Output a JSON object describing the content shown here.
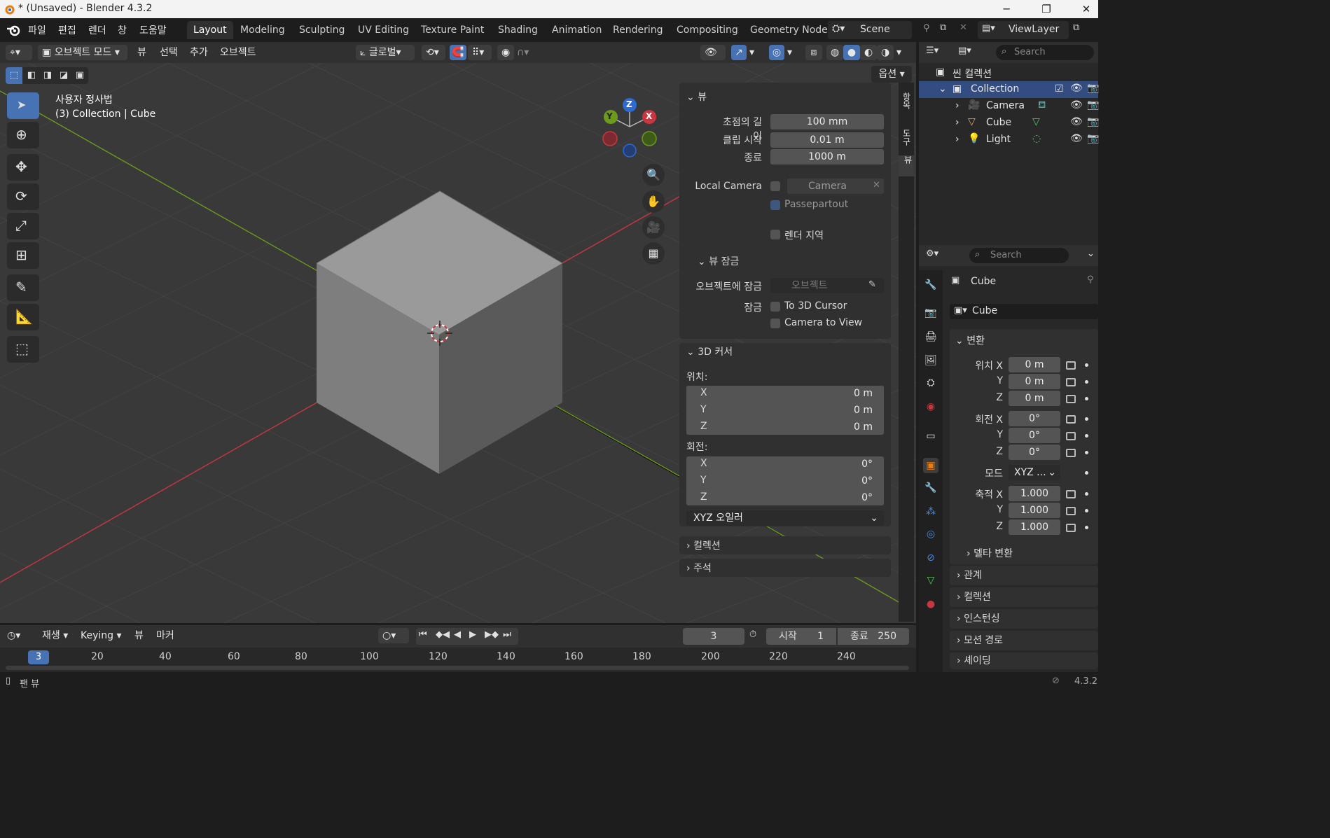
{
  "app": {
    "title": "* (Unsaved) - Blender 4.3.2"
  },
  "menu": [
    "파일",
    "편집",
    "렌더",
    "창",
    "도움말"
  ],
  "workspaces": [
    "Layout",
    "Modeling",
    "Sculpting",
    "UV Editing",
    "Texture Paint",
    "Shading",
    "Animation",
    "Rendering",
    "Compositing",
    "Geometry Node"
  ],
  "scene": {
    "label": "Scene",
    "view_layer": "ViewLayer"
  },
  "viewport_header": {
    "mode": "오브젝트 모드",
    "view": "뷰",
    "select": "선택",
    "add": "추가",
    "object": "오브젝트",
    "orientation": "글로벌",
    "options": "옵션"
  },
  "viewport": {
    "view_name": "사용자 정사법",
    "context": "(3) Collection | Cube",
    "gizmo": {
      "x": "X",
      "y": "Y",
      "z": "Z"
    }
  },
  "npanel": {
    "view_header": "뷰",
    "focal_label": "초점의 길이",
    "focal_value": "100 mm",
    "clip_start_label": "클립 시작",
    "clip_start_value": "0.01 m",
    "clip_end_label": "종료",
    "clip_end_value": "1000 m",
    "local_camera_label": "Local Camera",
    "local_camera_value": "Camera",
    "passepartout": "Passepartout",
    "render_region": "렌더 지역",
    "view_lock_header": "뷰 잠금",
    "lock_object_label": "오브젝트에 잠금",
    "lock_object_placeholder": "오브젝트",
    "lock_label": "잠금",
    "to_cursor": "To 3D Cursor",
    "cam_to_view": "Camera to View",
    "cursor_header": "3D 커서",
    "location_label": "위치:",
    "rotation_label": "회전:",
    "cursor_loc": [
      {
        "axis": "X",
        "value": "0 m"
      },
      {
        "axis": "Y",
        "value": "0 m"
      },
      {
        "axis": "Z",
        "value": "0 m"
      }
    ],
    "cursor_rot": [
      {
        "axis": "X",
        "value": "0°"
      },
      {
        "axis": "Y",
        "value": "0°"
      },
      {
        "axis": "Z",
        "value": "0°"
      }
    ],
    "rot_mode": "XYZ 오일러",
    "collection_header": "컬렉션",
    "annotation_header": "주석"
  },
  "sidetabs": [
    "항목",
    "도구",
    "뷰"
  ],
  "outliner": {
    "search_placeholder": "Search",
    "root": "씬 컬렉션",
    "collection": "Collection",
    "items": [
      "Camera",
      "Cube",
      "Light"
    ]
  },
  "properties": {
    "search_placeholder": "Search",
    "object_name": "Cube",
    "data_name": "Cube",
    "transform_header": "변환",
    "location_label": "위치 X",
    "rotation_label": "회전 X",
    "scale_label": "축적 X",
    "mode_label": "모드",
    "mode_value": "XYZ ...",
    "loc": [
      "0 m",
      "0 m",
      "0 m"
    ],
    "rot": [
      "0°",
      "0°",
      "0°"
    ],
    "scale": [
      "1.000",
      "1.000",
      "1.000"
    ],
    "axis_y": "Y",
    "axis_z": "Z",
    "delta": "델타 변환",
    "sections": [
      "관계",
      "컬렉션",
      "인스턴싱",
      "모션 경로",
      "셰이딩"
    ]
  },
  "timeline": {
    "playback": "재생",
    "keying": "Keying",
    "view": "뷰",
    "marker": "마커",
    "current_frame": "3",
    "start_label": "시작",
    "start": "1",
    "end_label": "종료",
    "end": "250",
    "ruler": [
      "20",
      "40",
      "60",
      "80",
      "100",
      "120",
      "140",
      "160",
      "180",
      "200",
      "220",
      "240"
    ]
  },
  "status": {
    "left": "팬 뷰",
    "version": "4.3.2"
  },
  "colors": {
    "accent": "#4772b3",
    "x_axis": "#c8373f",
    "y_axis": "#6b9a1e",
    "z_axis": "#2d6ad3"
  }
}
